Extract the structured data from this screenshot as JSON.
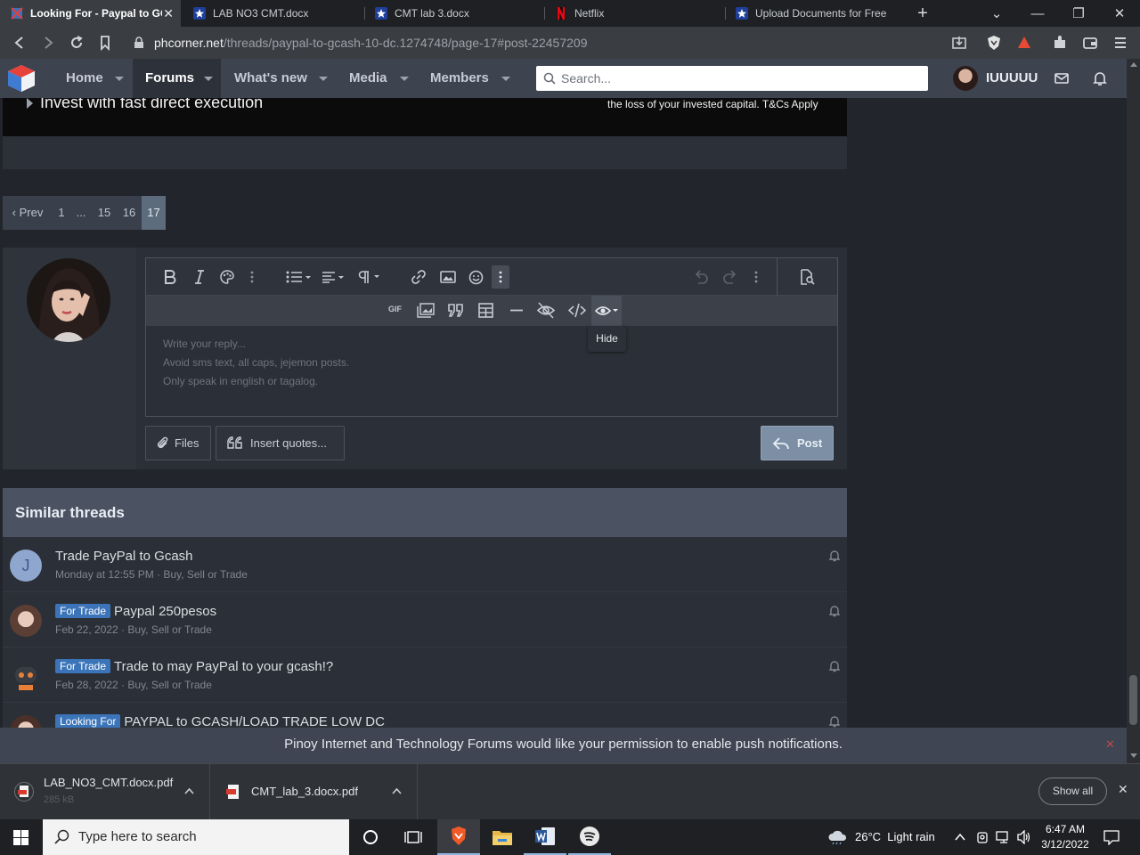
{
  "browser": {
    "tabs": [
      {
        "title": "Looking For - Paypal to GC",
        "active": true,
        "icon": "phcorner-favicon"
      },
      {
        "title": "LAB NO3 CMT.docx",
        "active": false,
        "icon": "star-favicon"
      },
      {
        "title": "CMT lab 3.docx",
        "active": false,
        "icon": "star-favicon"
      },
      {
        "title": "Netflix",
        "active": false,
        "icon": "netflix-favicon"
      },
      {
        "title": "Upload Documents for Free Ac",
        "active": false,
        "icon": "star-favicon"
      }
    ],
    "url_host": "phcorner.net",
    "url_path": "/threads/paypal-to-gcash-10-dc.1274748/page-17#post-22457209"
  },
  "site": {
    "nav": [
      {
        "label": "Home",
        "active": false
      },
      {
        "label": "Forums",
        "active": true
      },
      {
        "label": "What's new",
        "active": false
      },
      {
        "label": "Media",
        "active": false
      },
      {
        "label": "Members",
        "active": false
      }
    ],
    "search_placeholder": "Search...",
    "username": "IUUUUU"
  },
  "ad": {
    "left_text": "Invest with fast direct execution",
    "right_text": "the loss of your invested capital. T&Cs Apply"
  },
  "pagination": {
    "prev_label": "Prev",
    "pages": [
      "1",
      "...",
      "15",
      "16",
      "17"
    ],
    "current": "17"
  },
  "editor": {
    "placeholder_lines": [
      "Write your reply...",
      "Avoid sms text, all caps, jejemon posts.",
      "Only speak in english or tagalog."
    ],
    "tooltip": "Hide",
    "gif_label": "GIF",
    "files_label": "Files",
    "quotes_label": "Insert quotes...",
    "post_label": "Post"
  },
  "similar": {
    "heading": "Similar threads",
    "threads": [
      {
        "prefix": "",
        "title": "Trade PayPal to Gcash",
        "meta": "Monday at 12:55 PM · Buy, Sell or Trade",
        "avatar_letter": "J"
      },
      {
        "prefix": "For Trade",
        "title": "Paypal 250pesos",
        "meta": "Feb 22, 2022 · Buy, Sell or Trade",
        "avatar_letter": ""
      },
      {
        "prefix": "For Trade",
        "title": "Trade to may PayPal to your gcash!?",
        "meta": "Feb 28, 2022 · Buy, Sell or Trade",
        "avatar_letter": ""
      },
      {
        "prefix": "Looking For",
        "title": "PAYPAL to GCASH/LOAD TRADE LOW DC",
        "meta": "",
        "avatar_letter": ""
      }
    ]
  },
  "push_notice": "Pinoy Internet and Technology Forums would like your permission to enable push notifications.",
  "downloads": {
    "items": [
      {
        "name": "LAB_NO3_CMT.docx.pdf",
        "sub": "285 kB"
      },
      {
        "name": "CMT_lab_3.docx.pdf",
        "sub": ""
      }
    ],
    "show_all": "Show all"
  },
  "taskbar": {
    "search_placeholder": "Type here to search",
    "weather": "26°C  Light rain",
    "time": "6:47 AM",
    "date": "3/12/2022"
  },
  "colors": {
    "accent": "#3b74b8",
    "post_button": "#7c8fa5",
    "header": "#3e4350"
  }
}
